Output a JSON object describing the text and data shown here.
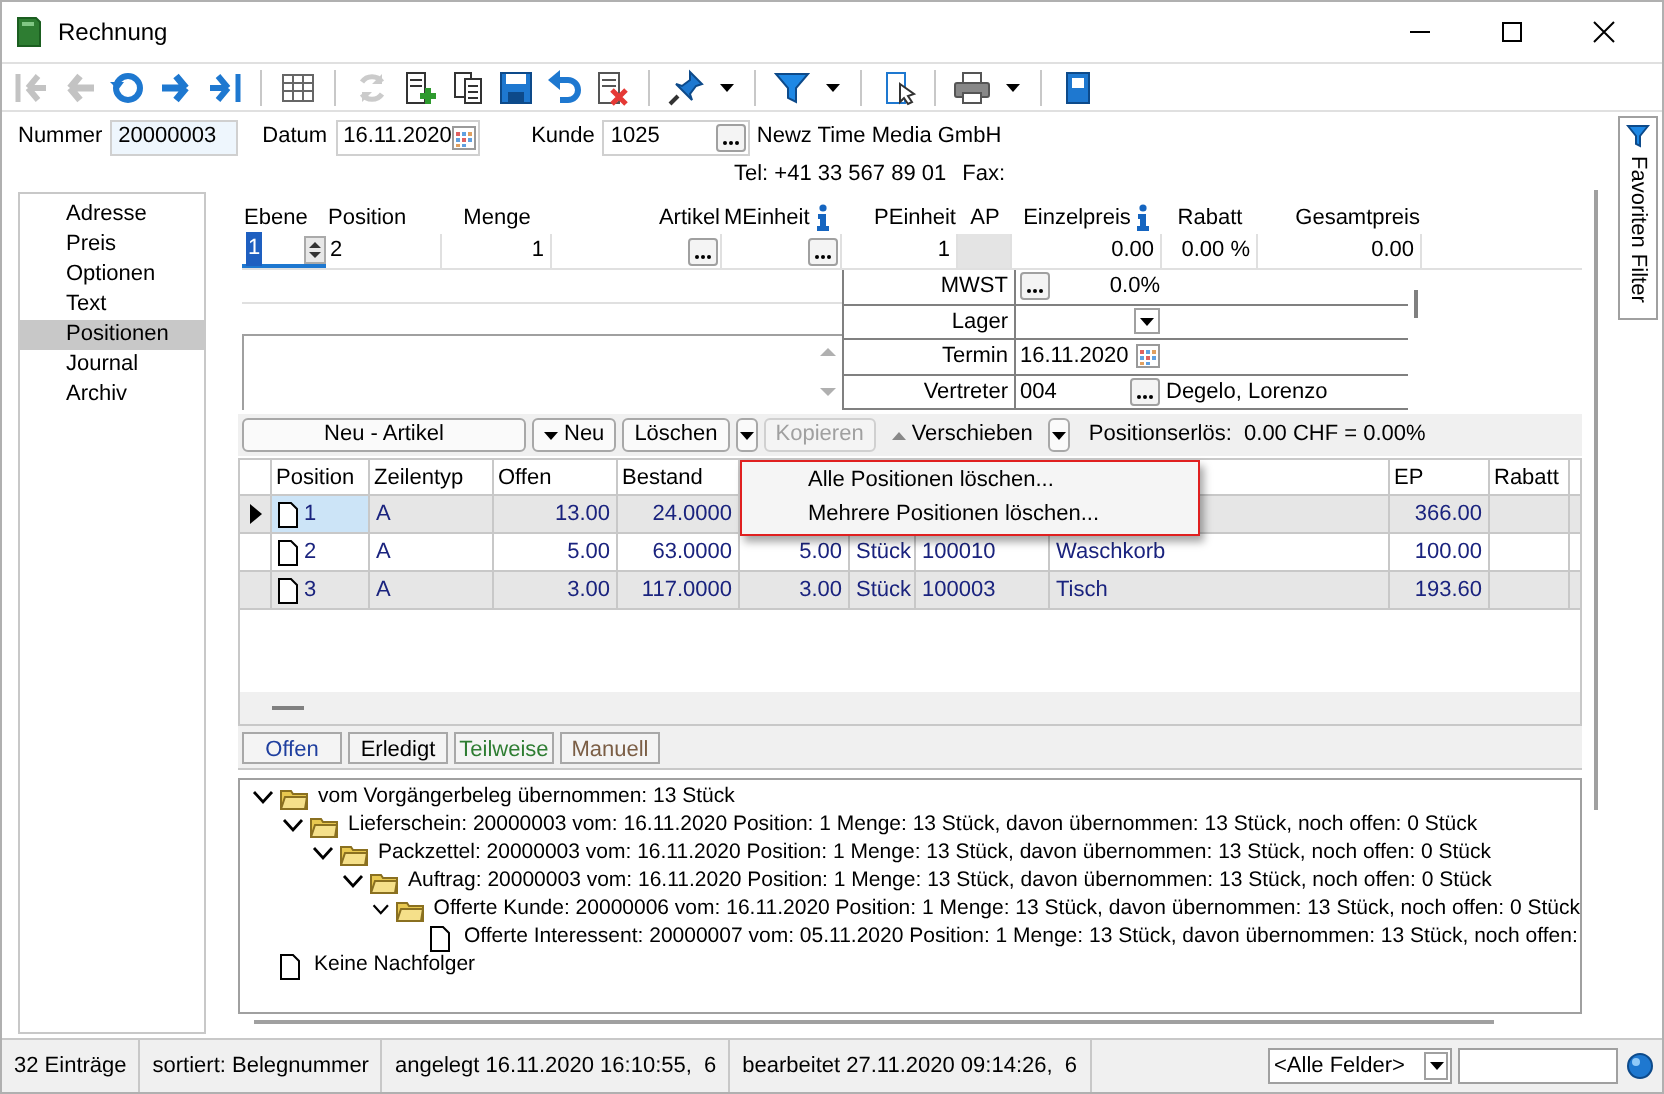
{
  "window": {
    "title": "Rechnung"
  },
  "toolbar": [
    {
      "disabled": true
    },
    {
      "disabled": true
    },
    {
      "disabled": false
    },
    {
      "disabled": false
    },
    {
      "disabled": false
    },
    {
      "disabled": false
    },
    {
      "disabled": true
    },
    {
      "disabled": false
    },
    {
      "disabled": false
    },
    {
      "disabled": false
    },
    {
      "disabled": false
    },
    {
      "disabled": false
    },
    {
      "disabled": false
    },
    {
      "disabled": false
    },
    {
      "disabled": false
    },
    {
      "disabled": false
    },
    {
      "disabled": false
    }
  ],
  "header": {
    "nummer": {
      "label": "Nummer",
      "value": "20000003"
    },
    "datum": {
      "label": "Datum",
      "value": "16.11.2020"
    },
    "kunde": {
      "label": "Kunde",
      "value": "1025",
      "name": "Newz Time Media GmbH",
      "phone": "Tel: +41 33 567 89 01",
      "fax": "Fax:"
    }
  },
  "sidebar": {
    "items": [
      {
        "label": "Adresse",
        "selected": false
      },
      {
        "label": "Preis",
        "selected": false
      },
      {
        "label": "Optionen",
        "selected": false
      },
      {
        "label": "Text",
        "selected": false
      },
      {
        "label": "Positionen",
        "selected": true
      },
      {
        "label": "Journal",
        "selected": false
      },
      {
        "label": "Archiv",
        "selected": false
      }
    ]
  },
  "position_form": {
    "fields": [
      {
        "label": "Ebene",
        "value": "1",
        "kind": "spin"
      },
      {
        "label": "Position",
        "value": "2",
        "kind": "text"
      },
      {
        "label": "Menge",
        "value": "1",
        "kind": "number"
      },
      {
        "label": "Artikel",
        "kind": "lookup"
      },
      {
        "label": "MEinheit",
        "kind": "lookup",
        "info": true
      },
      {
        "label": "PEinheit",
        "value": "1",
        "kind": "number"
      },
      {
        "label": "AP",
        "kind": "readonly"
      },
      {
        "label": "Einzelpreis",
        "value": "0.00",
        "kind": "number",
        "info": true
      },
      {
        "label": "Rabatt",
        "value": "0.00 %",
        "kind": "number"
      },
      {
        "label": "Gesamtpreis",
        "value": "0.00",
        "kind": "number"
      }
    ],
    "details": [
      {
        "label": "MWST",
        "kind": "percent",
        "value": "0.0%"
      },
      {
        "label": "Lager",
        "kind": "dropdown"
      },
      {
        "label": "Termin",
        "kind": "date",
        "value": "16.11.2020"
      },
      {
        "label": "Vertreter",
        "kind": "lookup",
        "value": "004",
        "extra": "Degelo, Lorenzo"
      }
    ]
  },
  "actions": [
    {
      "label": "Neu - Artikel",
      "kind": "wide",
      "disabled": false
    },
    {
      "label": "Neu",
      "kind": "menu",
      "disabled": false
    },
    {
      "label": "Löschen",
      "kind": "button",
      "disabled": false
    },
    {
      "kind": "dropdown",
      "disabled": false
    },
    {
      "label": "Kopieren",
      "kind": "button",
      "disabled": true
    },
    {
      "label": "Verschieben",
      "kind": "up",
      "disabled": false
    },
    {
      "kind": "dropdown",
      "disabled": false
    }
  ],
  "summary": "Positionserlös:  0.00 CHF = 0.00%",
  "context_menu": {
    "items": [
      {
        "label": "Alle Positionen löschen..."
      },
      {
        "label": "Mehrere Positionen löschen..."
      }
    ]
  },
  "table": {
    "columns": [
      "Position",
      "Zeilentyp",
      "Offen",
      "Bestand",
      null,
      null,
      null,
      null,
      "EP",
      "Rabatt"
    ],
    "rows": [
      {
        "selected": true,
        "cells": [
          "1",
          "A",
          "13.00",
          "24.0000",
          null,
          null,
          null,
          null,
          "366.00",
          null
        ]
      },
      {
        "selected": false,
        "cells": [
          "2",
          "A",
          "5.00",
          "63.0000",
          "5.00",
          "Stück",
          "100010",
          "Waschkorb",
          "100.00",
          null
        ]
      },
      {
        "selected": false,
        "cells": [
          "3",
          "A",
          "3.00",
          "117.0000",
          "3.00",
          "Stück",
          "100003",
          "Tisch",
          "193.60",
          null
        ]
      }
    ]
  },
  "status_filters": [
    {
      "label": "Offen",
      "color": "#1f3f9f"
    },
    {
      "label": "Erledigt",
      "color": "#000000"
    },
    {
      "label": "Teilweise",
      "color": "#2e7d32"
    },
    {
      "label": "Manuell",
      "color": "#7b5e45"
    }
  ],
  "history": {
    "items": [
      {
        "label": "vom Vorgängerbeleg übernommen: 13 Stück",
        "kind": "folder",
        "expanded": true,
        "children": [
          {
            "label": "Lieferschein: 20000003 vom: 16.11.2020 Position: 1 Menge: 13 Stück, davon übernommen: 13 Stück, noch offen: 0 Stück",
            "kind": "folder",
            "expanded": true,
            "children": [
              {
                "label": "Packzettel: 20000003 vom: 16.11.2020 Position: 1 Menge: 13 Stück, davon übernommen: 13 Stück, noch offen: 0 Stück",
                "kind": "folder",
                "expanded": true,
                "children": [
                  {
                    "label": "Auftrag: 20000003 vom: 16.11.2020 Position: 1 Menge: 13 Stück, davon übernommen: 13 Stück, noch offen: 0 Stück",
                    "kind": "folder",
                    "expanded": true,
                    "children": [
                      {
                        "label": "Offerte Kunde: 20000006 vom: 16.11.2020 Position: 1 Menge: 13 Stück, davon übernommen: 13 Stück, noch offen: 0 Stück",
                        "kind": "folder",
                        "expanded": true,
                        "children": [
                          {
                            "label": "Offerte Interessent: 20000007 vom: 05.11.2020 Position: 1 Menge: 13 Stück, davon übernommen: 13 Stück, noch offen:",
                            "kind": "document"
                          }
                        ]
                      }
                    ]
                  }
                ]
              }
            ]
          }
        ]
      },
      {
        "label": "Keine Nachfolger",
        "kind": "document"
      }
    ]
  },
  "status_bar": {
    "items": [
      "32 Einträge",
      "sortiert: Belegnummer",
      "angelegt 16.11.2020 16:10:55,  6",
      "bearbeitet 27.11.2020 09:14:26,  6"
    ],
    "field_filter": "<Alle Felder>"
  },
  "favorites_tab": {
    "label": "Favoriten Filter"
  }
}
